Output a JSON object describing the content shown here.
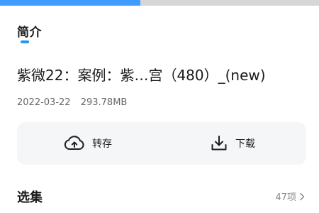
{
  "progress": {
    "fraction": 0.44
  },
  "tab": {
    "title": "简介"
  },
  "file": {
    "title": "紫微22：案例：紫…宫（480）_(new)",
    "date": "2022-03-22",
    "size": "293.78MB"
  },
  "actions": {
    "save_label": "转存",
    "download_label": "下载",
    "save_icon": "cloud-upload-icon",
    "download_icon": "download-icon"
  },
  "episodes": {
    "title": "选集",
    "count": "47项"
  },
  "colors": {
    "accent": "#2196f3",
    "progress": "#3f9bff"
  }
}
